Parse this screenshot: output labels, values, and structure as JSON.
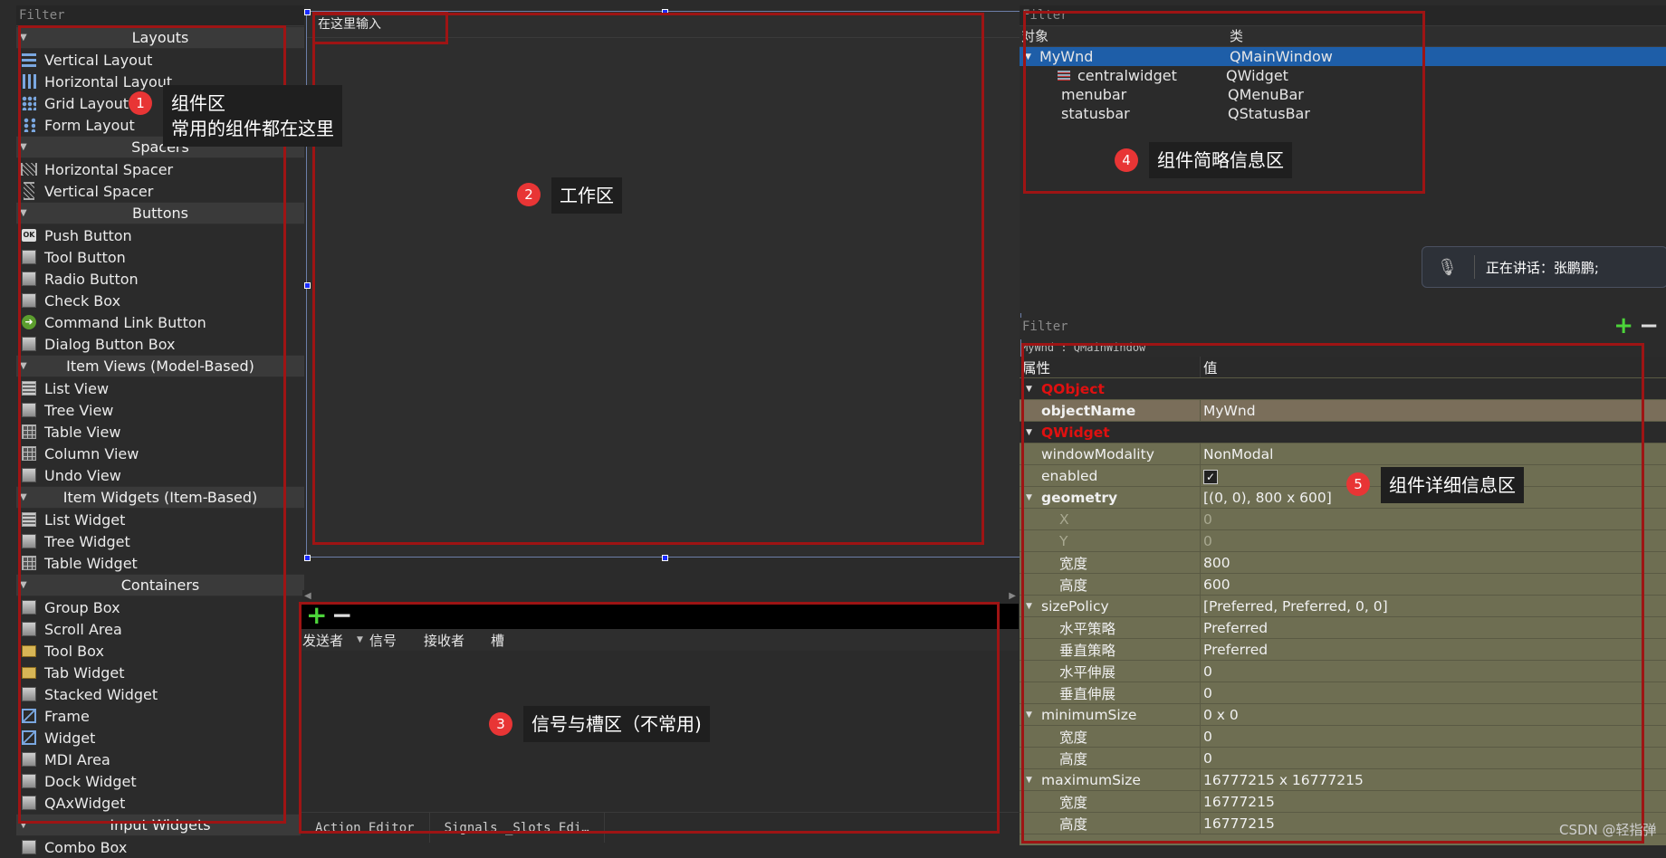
{
  "widget_box": {
    "filter_placeholder": "Filter",
    "categories": [
      {
        "title": "Layouts",
        "items": [
          {
            "label": "Vertical Layout",
            "icon": "vertical-layout-icon"
          },
          {
            "label": "Horizontal Layout",
            "icon": "horizontal-layout-icon"
          },
          {
            "label": "Grid Layout",
            "icon": "grid-layout-icon"
          },
          {
            "label": "Form Layout",
            "icon": "form-layout-icon"
          }
        ]
      },
      {
        "title": "Spacers",
        "items": [
          {
            "label": "Horizontal Spacer",
            "icon": "horizontal-spacer-icon"
          },
          {
            "label": "Vertical Spacer",
            "icon": "vertical-spacer-icon"
          }
        ]
      },
      {
        "title": "Buttons",
        "items": [
          {
            "label": "Push Button",
            "icon": "push-button-icon"
          },
          {
            "label": "Tool Button",
            "icon": "tool-button-icon"
          },
          {
            "label": "Radio Button",
            "icon": "radio-button-icon"
          },
          {
            "label": "Check Box",
            "icon": "check-box-icon"
          },
          {
            "label": "Command Link Button",
            "icon": "command-link-icon"
          },
          {
            "label": "Dialog Button Box",
            "icon": "dialog-button-box-icon"
          }
        ]
      },
      {
        "title": "Item Views (Model-Based)",
        "items": [
          {
            "label": "List View",
            "icon": "list-view-icon"
          },
          {
            "label": "Tree View",
            "icon": "tree-view-icon"
          },
          {
            "label": "Table View",
            "icon": "table-view-icon"
          },
          {
            "label": "Column View",
            "icon": "column-view-icon"
          },
          {
            "label": "Undo View",
            "icon": "undo-view-icon"
          }
        ]
      },
      {
        "title": "Item Widgets (Item-Based)",
        "items": [
          {
            "label": "List Widget",
            "icon": "list-widget-icon"
          },
          {
            "label": "Tree Widget",
            "icon": "tree-widget-icon"
          },
          {
            "label": "Table Widget",
            "icon": "table-widget-icon"
          }
        ]
      },
      {
        "title": "Containers",
        "items": [
          {
            "label": "Group Box",
            "icon": "group-box-icon"
          },
          {
            "label": "Scroll Area",
            "icon": "scroll-area-icon"
          },
          {
            "label": "Tool Box",
            "icon": "tool-box-icon"
          },
          {
            "label": "Tab Widget",
            "icon": "tab-widget-icon"
          },
          {
            "label": "Stacked Widget",
            "icon": "stacked-widget-icon"
          },
          {
            "label": "Frame",
            "icon": "frame-icon"
          },
          {
            "label": "Widget",
            "icon": "widget-icon"
          },
          {
            "label": "MDI Area",
            "icon": "mdi-area-icon"
          },
          {
            "label": "Dock Widget",
            "icon": "dock-widget-icon"
          },
          {
            "label": "QAxWidget",
            "icon": "qaxwidget-icon"
          }
        ]
      },
      {
        "title": "Input Widgets",
        "items": [
          {
            "label": "Combo Box",
            "icon": "combo-box-icon"
          }
        ]
      }
    ]
  },
  "work_area": {
    "menubar_placeholder": "在这里输入"
  },
  "signal_slot": {
    "add_icon": "+",
    "remove_icon": "−",
    "columns": [
      "发送者",
      "信号",
      "接收者",
      "槽"
    ],
    "tabs": [
      "Action Editor",
      "Signals _Slots Edi…"
    ]
  },
  "object_inspector": {
    "filter_placeholder": "Filter",
    "columns": [
      "对象",
      "类"
    ],
    "rows": [
      {
        "object": "MyWnd",
        "class": "QMainWindow",
        "level": 0,
        "selected": true
      },
      {
        "object": "centralwidget",
        "class": "QWidget",
        "level": 1,
        "selected": false
      },
      {
        "object": "menubar",
        "class": "QMenuBar",
        "level": 1,
        "selected": false
      },
      {
        "object": "statusbar",
        "class": "QStatusBar",
        "level": 1,
        "selected": false
      }
    ]
  },
  "voice_overlay": {
    "text": "正在讲话：张鹏鹏;"
  },
  "property_editor": {
    "filter_placeholder": "Filter",
    "context": "MyWnd : QMainWindow",
    "columns": [
      "属性",
      "值"
    ],
    "rows": [
      {
        "key": "QObject",
        "value": "",
        "type": "group"
      },
      {
        "key": "objectName",
        "value": "MyWnd",
        "type": "hl"
      },
      {
        "key": "QWidget",
        "value": "",
        "type": "group"
      },
      {
        "key": "windowModality",
        "value": "NonModal",
        "type": "normal"
      },
      {
        "key": "enabled",
        "value": "✓",
        "type": "check"
      },
      {
        "key": "geometry",
        "value": "[(0, 0), 800 x 600]",
        "type": "bold-exp"
      },
      {
        "key": "X",
        "value": "0",
        "type": "sub-dim"
      },
      {
        "key": "Y",
        "value": "0",
        "type": "sub-dim"
      },
      {
        "key": "宽度",
        "value": "800",
        "type": "sub"
      },
      {
        "key": "高度",
        "value": "600",
        "type": "sub"
      },
      {
        "key": "sizePolicy",
        "value": "[Preferred, Preferred, 0, 0]",
        "type": "exp"
      },
      {
        "key": "水平策略",
        "value": "Preferred",
        "type": "sub"
      },
      {
        "key": "垂直策略",
        "value": "Preferred",
        "type": "sub"
      },
      {
        "key": "水平伸展",
        "value": "0",
        "type": "sub"
      },
      {
        "key": "垂直伸展",
        "value": "0",
        "type": "sub"
      },
      {
        "key": "minimumSize",
        "value": "0 x 0",
        "type": "exp"
      },
      {
        "key": "宽度",
        "value": "0",
        "type": "sub"
      },
      {
        "key": "高度",
        "value": "0",
        "type": "sub"
      },
      {
        "key": "maximumSize",
        "value": "16777215 x 16777215",
        "type": "exp"
      },
      {
        "key": "宽度",
        "value": "16777215",
        "type": "sub"
      },
      {
        "key": "高度",
        "value": "16777215",
        "type": "sub"
      }
    ]
  },
  "annotations": [
    {
      "num": "1",
      "text": "组件区\n常用的组件都在这里"
    },
    {
      "num": "2",
      "text": "工作区"
    },
    {
      "num": "3",
      "text": "信号与槽区（不常用)"
    },
    {
      "num": "4",
      "text": "组件简略信息区"
    },
    {
      "num": "5",
      "text": "组件详细信息区"
    }
  ],
  "watermark": "CSDN @轻指弹",
  "colors": {
    "annotation_red": "#9e1414",
    "badge_red": "#e83535",
    "selection_blue": "#1e5ea8",
    "property_bg": "#6e6e52",
    "group_red": "#e01010"
  }
}
